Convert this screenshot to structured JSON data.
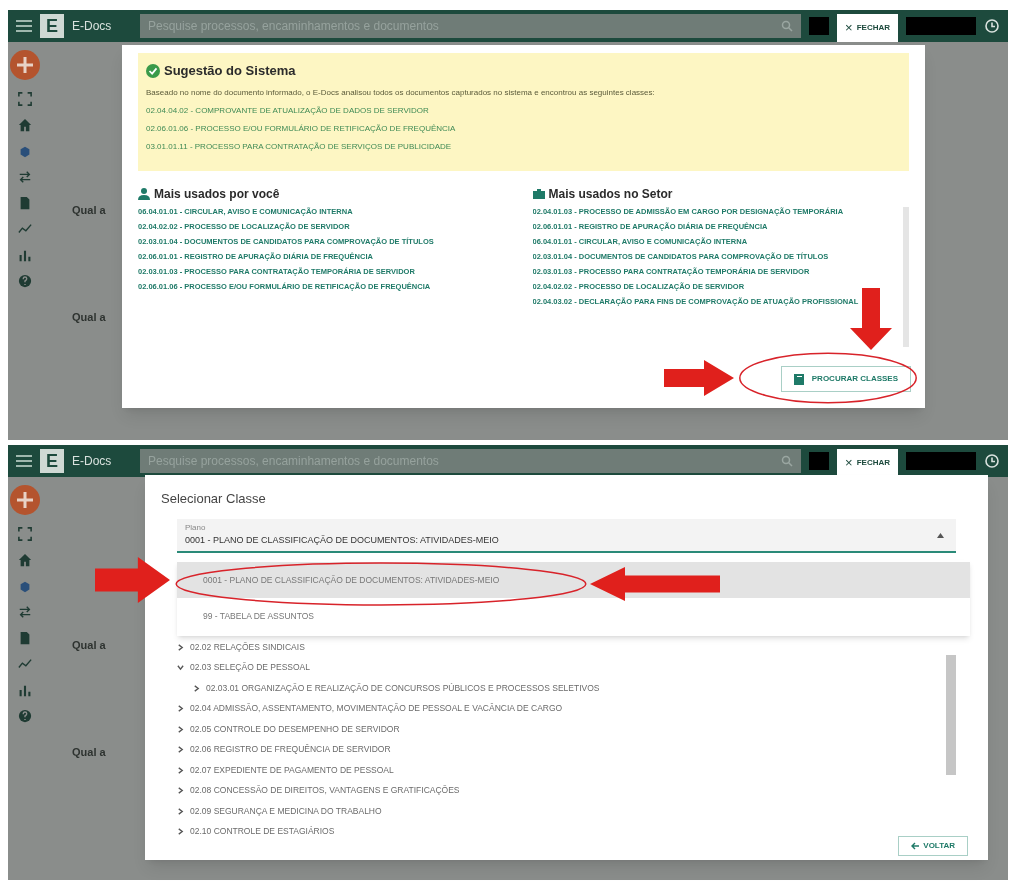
{
  "panels": [
    {
      "kind": "suggestion",
      "app_bar": {
        "logo_letter": "E",
        "app_name": "E-Docs",
        "search_placeholder": "Pesquise processos, encaminhamentos e documentos",
        "close_icon": "×",
        "close_label": "FECHAR"
      },
      "background_labels": [
        "Qual a",
        "Qual a"
      ],
      "suggestion": {
        "title": "Sugestão do Sistema",
        "description": "Baseado no nome do documento informado, o E-Docs analisou todos os documentos capturados no sistema e encontrou as seguintes classes:",
        "items": [
          "02.04.04.02 - COMPROVANTE DE ATUALIZAÇÃO DE DADOS DE SERVIDOR",
          "02.06.01.06 - PROCESSO E/OU FORMULÁRIO DE RETIFICAÇÃO DE FREQUÊNCIA",
          "03.01.01.11 - PROCESSO PARA CONTRATAÇÃO DE SERVIÇOS DE PUBLICIDADE"
        ]
      },
      "personal": {
        "title": "Mais usados por você",
        "items": [
          "06.04.01.01 - CIRCULAR, AVISO E COMUNICAÇÃO INTERNA",
          "02.04.02.02 - PROCESSO DE LOCALIZAÇÃO DE SERVIDOR",
          "02.03.01.04 - DOCUMENTOS DE CANDIDATOS PARA COMPROVAÇÃO DE TÍTULOS",
          "02.06.01.01 - REGISTRO DE APURAÇÃO DIÁRIA DE FREQUÊNCIA",
          "02.03.01.03 - PROCESSO PARA CONTRATAÇÃO TEMPORÁRIA DE SERVIDOR",
          "02.06.01.06 - PROCESSO E/OU FORMULÁRIO DE RETIFICAÇÃO DE FREQUÊNCIA"
        ]
      },
      "sector": {
        "title": "Mais usados no Setor",
        "items": [
          "02.04.01.03 - PROCESSO DE ADMISSÃO EM CARGO POR DESIGNAÇÃO TEMPORÁRIA",
          "02.06.01.01 - REGISTRO DE APURAÇÃO DIÁRIA DE FREQUÊNCIA",
          "06.04.01.01 - CIRCULAR, AVISO E COMUNICAÇÃO INTERNA",
          "02.03.01.04 - DOCUMENTOS DE CANDIDATOS PARA COMPROVAÇÃO DE TÍTULOS",
          "02.03.01.03 - PROCESSO PARA CONTRATAÇÃO TEMPORÁRIA DE SERVIDOR",
          "02.04.02.02 - PROCESSO DE LOCALIZAÇÃO DE SERVIDOR",
          "02.04.03.02 - DECLARAÇÃO PARA FINS DE COMPROVAÇÃO DE ATUAÇÃO PROFISSIONAL"
        ]
      },
      "button": "PROCURAR CLASSES"
    },
    {
      "kind": "select",
      "app_bar": {
        "logo_letter": "E",
        "app_name": "E-Docs",
        "search_placeholder": "Pesquise processos, encaminhamentos e documentos",
        "close_icon": "×",
        "close_label": "FECHAR"
      },
      "background_labels": [
        "Qual a",
        "Qual a"
      ],
      "title": "Selecionar Classe",
      "field": {
        "label": "Plano",
        "value": "0001 - PLANO DE CLASSIFICAÇÃO DE DOCUMENTOS: ATIVIDADES-MEIO"
      },
      "options": [
        {
          "label": "0001 - PLANO DE CLASSIFICAÇÃO DE DOCUMENTOS: ATIVIDADES-MEIO",
          "selected": true
        },
        {
          "label": "99 - TABELA DE ASSUNTOS",
          "selected": false
        }
      ],
      "tree": [
        {
          "label": "02.02 RELAÇÕES SINDICAIS",
          "expanded": false
        },
        {
          "label": "02.03 SELEÇÃO DE PESSOAL",
          "expanded": true,
          "children": [
            {
              "label": "02.03.01 ORGANIZAÇÃO E REALIZAÇÃO DE CONCURSOS PÚBLICOS E PROCESSOS SELETIVOS",
              "expanded": false
            }
          ]
        },
        {
          "label": "02.04 ADMISSÃO, ASSENTAMENTO, MOVIMENTAÇÃO DE PESSOAL E VACÂNCIA DE CARGO",
          "expanded": false
        },
        {
          "label": "02.05 CONTROLE DO DESEMPENHO DE SERVIDOR",
          "expanded": false
        },
        {
          "label": "02.06 REGISTRO DE FREQUÊNCIA DE SERVIDOR",
          "expanded": false
        },
        {
          "label": "02.07 EXPEDIENTE DE PAGAMENTO DE PESSOAL",
          "expanded": false
        },
        {
          "label": "02.08 CONCESSÃO DE DIREITOS, VANTAGENS E GRATIFICAÇÕES",
          "expanded": false
        },
        {
          "label": "02.09 SEGURANÇA E MEDICINA DO TRABALHO",
          "expanded": false
        },
        {
          "label": "02.10 CONTROLE DE ESTAGIÁRIOS",
          "expanded": false
        }
      ],
      "back_button": "VOLTAR"
    }
  ]
}
